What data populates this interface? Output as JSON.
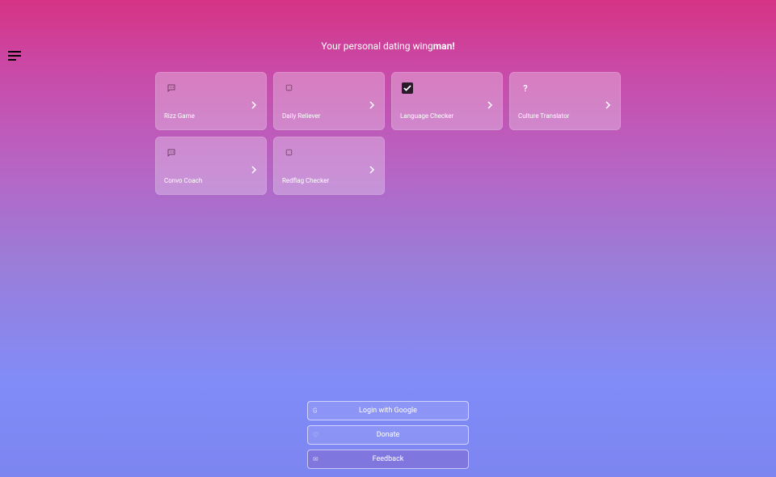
{
  "tagline_prefix": "Your personal dating wing",
  "tagline_bold": "man!",
  "cards": [
    {
      "icon": "chat-icon",
      "label": "Rizz Game"
    },
    {
      "icon": "brain-icon",
      "label": "Daily Reliever"
    },
    {
      "icon": "check-icon",
      "label": "Language Checker"
    },
    {
      "icon": "question-icon",
      "label": "Culture Translator"
    },
    {
      "icon": "chat-icon",
      "label": "Convo Coach"
    },
    {
      "icon": "brain-icon",
      "label": "Redflag Checker"
    }
  ],
  "buttons": {
    "login": "Login with Google",
    "donate": "Donate",
    "feedback": "Feedback"
  }
}
